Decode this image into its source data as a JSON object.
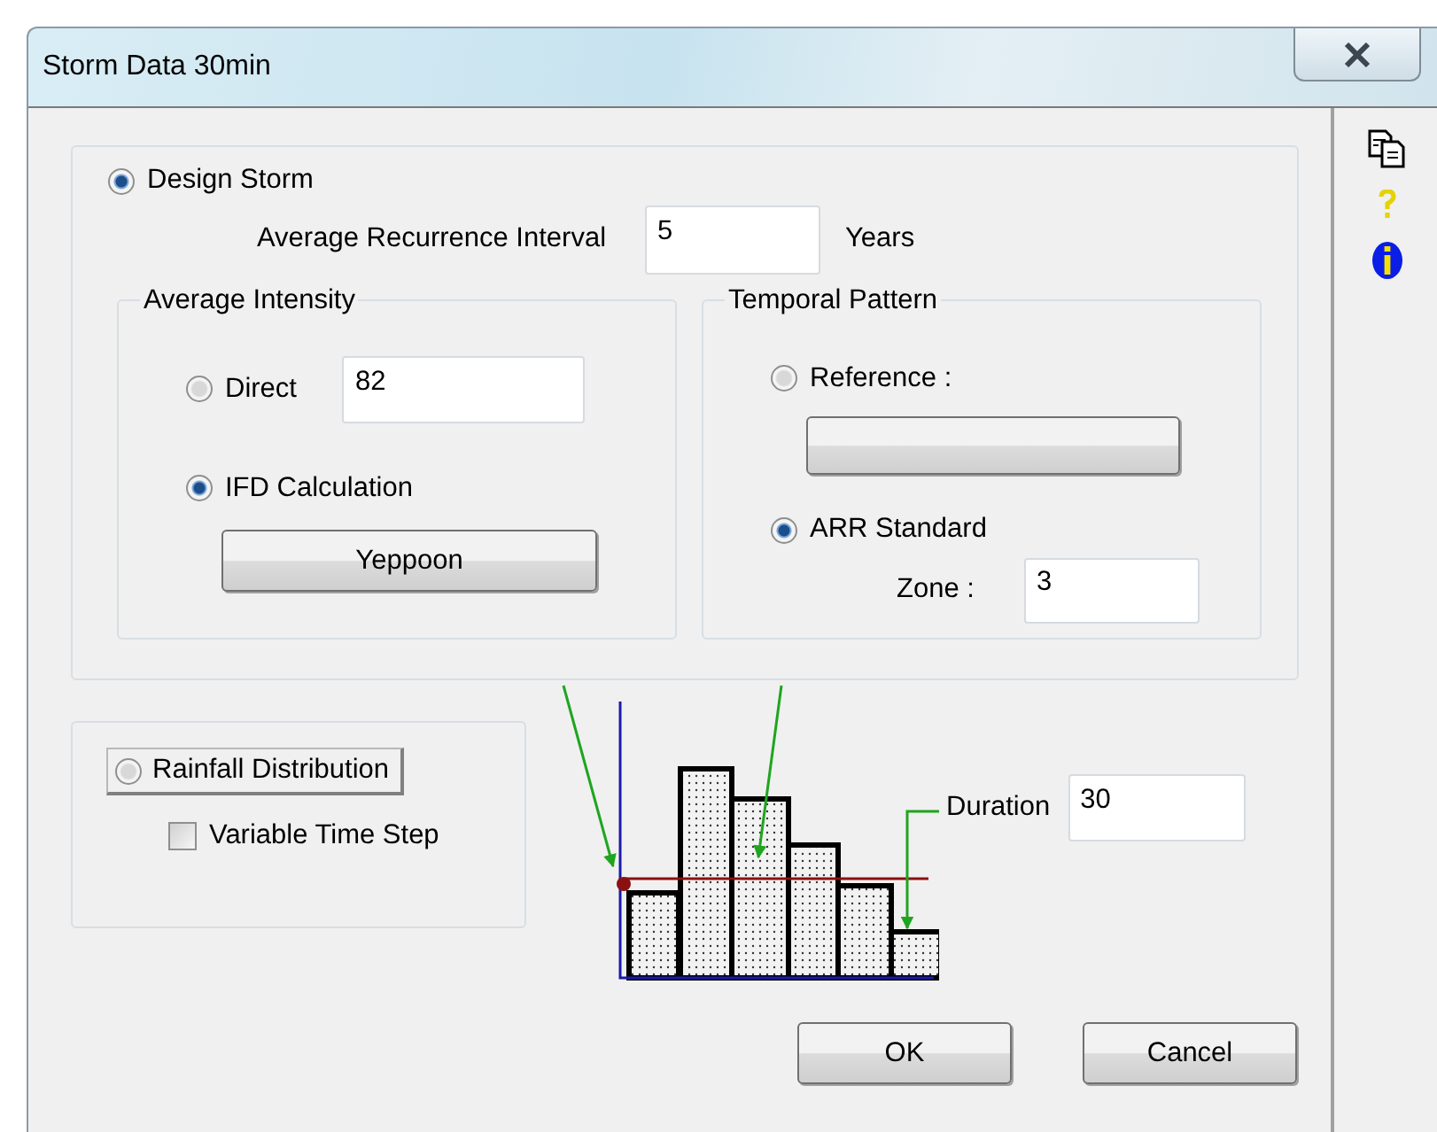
{
  "window": {
    "title": "Storm Data  30min"
  },
  "design_storm": {
    "label": "Design Storm",
    "selected": true,
    "recurrence_label": "Average Recurrence Interval",
    "recurrence_value": "5",
    "recurrence_unit": "Years"
  },
  "average_intensity": {
    "title": "Average Intensity",
    "direct": {
      "label": "Direct",
      "selected": false,
      "value": "82"
    },
    "ifd": {
      "label": "IFD Calculation",
      "selected": true,
      "button": "Yeppoon"
    }
  },
  "temporal_pattern": {
    "title": "Temporal Pattern",
    "reference": {
      "label": "Reference :",
      "selected": false
    },
    "standard": {
      "label": "ARR Standard",
      "selected": true,
      "zone_label": "Zone :",
      "zone_value": "3"
    }
  },
  "rainfall_distribution": {
    "label": "Rainfall Distribution",
    "selected": false
  },
  "variable_time_step": {
    "label": "Variable Time Step",
    "checked": false
  },
  "duration": {
    "label": "Duration",
    "value": "30"
  },
  "buttons": [
    "OK",
    "Cancel"
  ]
}
